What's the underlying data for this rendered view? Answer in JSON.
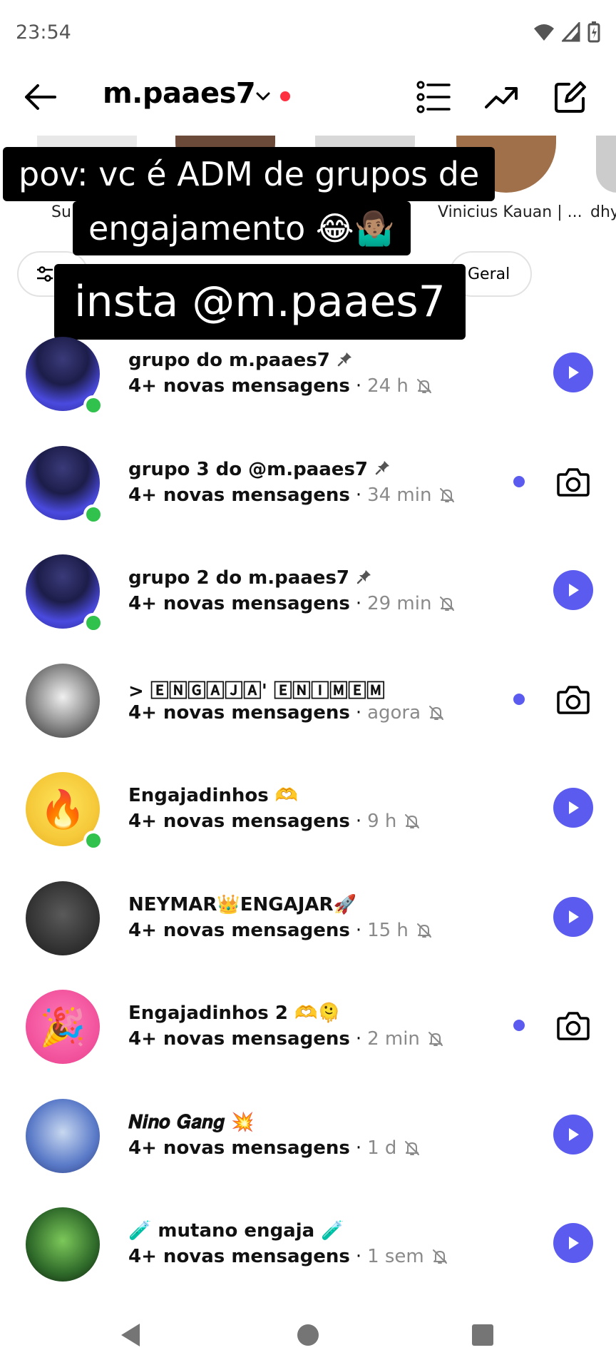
{
  "status_bar": {
    "time": "23:54"
  },
  "header": {
    "username": "m.paaes7"
  },
  "notes": [
    {
      "label": "Su"
    },
    {
      "label": "Vinicius Kauan | ..."
    },
    {
      "label": "dhy"
    }
  ],
  "filter_chips": [
    {
      "label": "Geral"
    }
  ],
  "overlay": {
    "line1": "pov: vc é ADM de grupos de",
    "line2": "engajamento 😂🤷🏽‍♂️",
    "line3": "insta @m.paaes7"
  },
  "chats": [
    {
      "name": "grupo do m.paaes7",
      "pinned": true,
      "messages": "4+ novas mensagens",
      "time": "24 h",
      "online": true,
      "unread_dot": false,
      "action": "play",
      "avatar_style": "night"
    },
    {
      "name": "grupo 3 do @m.paaes7",
      "pinned": true,
      "messages": "4+ novas mensagens",
      "time": "34 min",
      "online": true,
      "unread_dot": true,
      "action": "camera",
      "avatar_style": "night"
    },
    {
      "name": "grupo 2 do m.paaes7",
      "pinned": true,
      "messages": "4+ novas mensagens",
      "time": "29 min",
      "online": true,
      "unread_dot": false,
      "action": "play",
      "avatar_style": "night"
    },
    {
      "name": "> 🄴🄽🄶🄰🄹🄰' 🄴🄽🄸🄼🄴🄼",
      "pinned": false,
      "messages": "4+ novas mensagens",
      "time": "agora",
      "online": false,
      "unread_dot": true,
      "action": "camera",
      "avatar_style": "bw"
    },
    {
      "name": "Engajadinhos 🫶",
      "pinned": false,
      "messages": "4+ novas mensagens",
      "time": "9 h",
      "online": true,
      "unread_dot": false,
      "action": "play",
      "avatar_style": "fire"
    },
    {
      "name": "NEYMAR👑ENGAJAR🚀",
      "pinned": false,
      "messages": "4+ novas mensagens",
      "time": "15 h",
      "online": false,
      "unread_dot": false,
      "action": "play",
      "avatar_style": "dark"
    },
    {
      "name": "Engajadinhos 2  🫶🫠",
      "pinned": false,
      "messages": "4+ novas mensagens",
      "time": "2 min",
      "online": false,
      "unread_dot": true,
      "action": "camera",
      "avatar_style": "party"
    },
    {
      "name": "𝑵𝒊𝒏𝒐 𝑮𝒂𝒏𝒈 💥",
      "pinned": false,
      "messages": "4+ novas mensagens",
      "time": "1 d",
      "online": false,
      "unread_dot": false,
      "action": "play",
      "avatar_style": "blue"
    },
    {
      "name": "🧪 mutano engaja 🧪",
      "pinned": false,
      "messages": "4+ novas mensagens",
      "time": "1 sem",
      "online": false,
      "unread_dot": false,
      "action": "play",
      "avatar_style": "green"
    }
  ],
  "colors": {
    "accent": "#5b5bf0",
    "online": "#31c24e",
    "notification": "#ff3040",
    "muted_text": "#8a8a8a"
  },
  "icons": {
    "back": "arrow-left-icon",
    "chevron": "chevron-down-icon",
    "list": "list-icon",
    "trending": "trending-up-icon",
    "compose": "edit-icon",
    "mute": "bell-off-icon",
    "pin": "pin-icon",
    "play": "play-icon",
    "camera": "camera-icon"
  }
}
